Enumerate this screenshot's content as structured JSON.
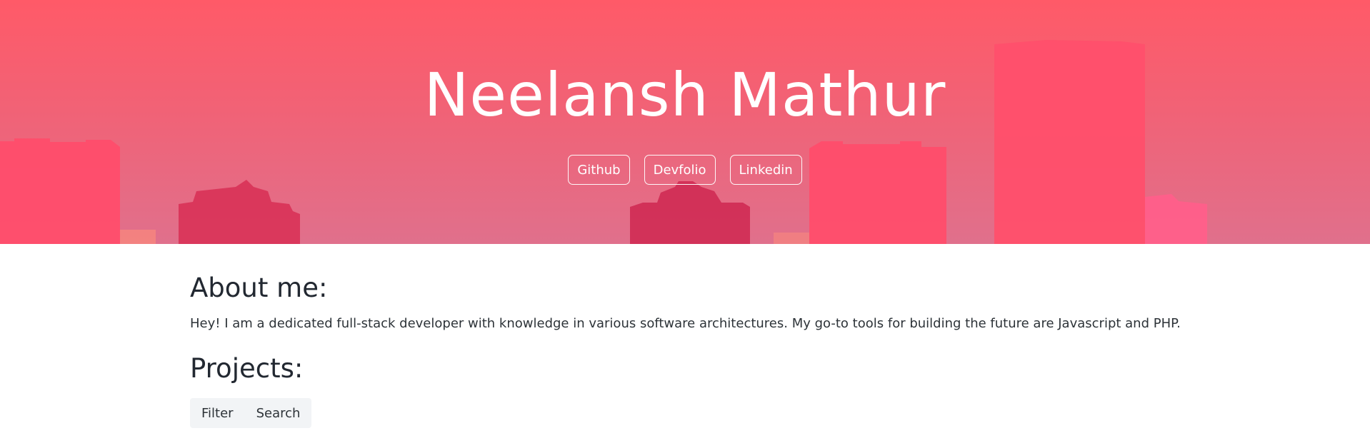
{
  "hero": {
    "title": "Neelansh Mathur",
    "links": [
      {
        "label": "Github"
      },
      {
        "label": "Devfolio"
      },
      {
        "label": "Linkedin"
      }
    ],
    "colors": {
      "top": "#ff5a68",
      "bottom": "#e0708c",
      "buildings": "#ff4d6b"
    }
  },
  "about": {
    "heading": "About me:",
    "text": "Hey! I am a dedicated full-stack developer with knowledge in various software architectures. My go-to tools for building the future are Javascript and PHP."
  },
  "projects": {
    "heading": "Projects:",
    "controls": [
      {
        "label": "Filter"
      },
      {
        "label": "Search"
      }
    ]
  }
}
